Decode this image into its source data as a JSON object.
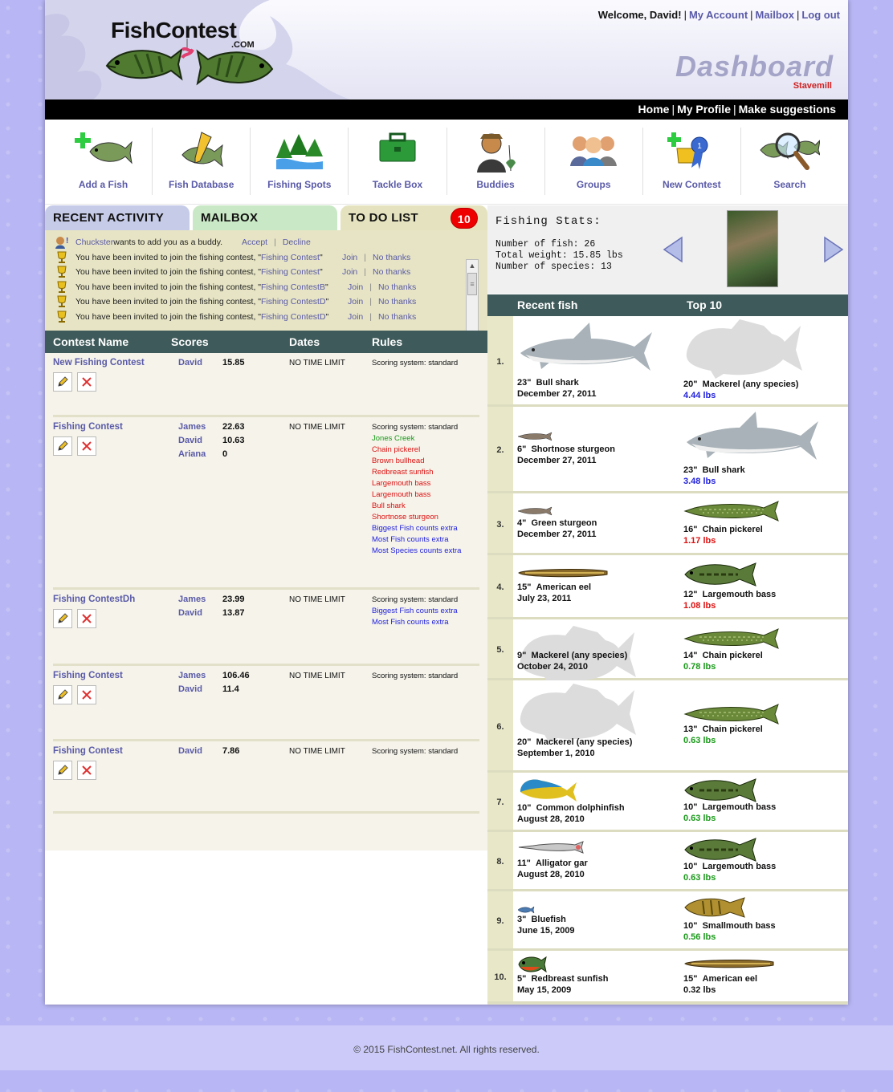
{
  "header": {
    "logo": "FishContest",
    "logo_sub": ".COM",
    "welcome": "Welcome, David!",
    "my_account": "My Account",
    "mailbox": "Mailbox",
    "logout": "Log out",
    "page_title": "Dashboard",
    "page_sub": "Stavemill"
  },
  "topnav": {
    "home": "Home",
    "profile": "My Profile",
    "suggest": "Make suggestions"
  },
  "iconbar": [
    {
      "label": "Add a Fish",
      "icon": "add-fish-icon"
    },
    {
      "label": "Fish Database",
      "icon": "fish-database-icon"
    },
    {
      "label": "Fishing Spots",
      "icon": "fishing-spots-icon"
    },
    {
      "label": "Tackle Box",
      "icon": "tackle-box-icon"
    },
    {
      "label": "Buddies",
      "icon": "buddies-icon"
    },
    {
      "label": "Groups",
      "icon": "groups-icon"
    },
    {
      "label": "New Contest",
      "icon": "new-contest-icon"
    },
    {
      "label": "Search",
      "icon": "search-icon"
    }
  ],
  "tabs": {
    "recent": "RECENT ACTIVITY",
    "mailbox": "MAILBOX",
    "todo": "TO DO LIST",
    "todo_count": "10"
  },
  "activity": [
    {
      "user": "Chuckster",
      "text": " wants to add you as a buddy.",
      "a1": "Accept",
      "a2": "Decline"
    },
    {
      "text": "You have been invited to join the fishing contest, \"",
      "contest": "Fishing Contest",
      "a1": "Join",
      "a2": "No thanks"
    },
    {
      "text": "You have been invited to join the fishing contest, \"",
      "contest": "Fishing Contest",
      "a1": "Join",
      "a2": "No thanks"
    },
    {
      "text": "You have been invited to join the fishing contest, \"",
      "contest": "Fishing ContestB",
      "a1": "Join",
      "a2": "No thanks"
    },
    {
      "text": "You have been invited to join the fishing contest, \"",
      "contest": "Fishing ContestD",
      "a1": "Join",
      "a2": "No thanks"
    },
    {
      "text": "You have been invited to join the fishing contest, \"",
      "contest": "Fishing ContestD",
      "a1": "Join",
      "a2": "No thanks"
    }
  ],
  "contest_table": {
    "headers": [
      "Contest Name",
      "Scores",
      "Dates",
      "Rules"
    ],
    "rows": [
      {
        "name": "New Fishing Contest",
        "players": [
          "David"
        ],
        "scores": [
          "15.85"
        ],
        "dates": "NO TIME LIMIT",
        "rules": [
          {
            "t": "Scoring system: standard",
            "c": ""
          }
        ]
      },
      {
        "name": "Fishing Contest",
        "players": [
          "James",
          "David",
          "Ariana"
        ],
        "scores": [
          "22.63",
          "10.63",
          "0"
        ],
        "dates": "NO TIME LIMIT",
        "rules": [
          {
            "t": "Scoring system: standard",
            "c": ""
          },
          {
            "t": "Jones Creek",
            "c": "r-green"
          },
          {
            "t": "Chain pickerel",
            "c": "r-red"
          },
          {
            "t": "Brown bullhead",
            "c": "r-red"
          },
          {
            "t": "Redbreast sunfish",
            "c": "r-red"
          },
          {
            "t": "Largemouth bass",
            "c": "r-red"
          },
          {
            "t": "Largemouth bass",
            "c": "r-red"
          },
          {
            "t": "Bull shark",
            "c": "r-red"
          },
          {
            "t": "Shortnose sturgeon",
            "c": "r-red"
          },
          {
            "t": "Biggest Fish counts extra",
            "c": "r-blue"
          },
          {
            "t": "Most Fish counts extra",
            "c": "r-blue"
          },
          {
            "t": "Most Species counts extra",
            "c": "r-blue"
          }
        ]
      },
      {
        "name": "Fishing ContestDh",
        "players": [
          "James",
          "David"
        ],
        "scores": [
          "23.99",
          "13.87"
        ],
        "dates": "NO TIME LIMIT",
        "rules": [
          {
            "t": "Scoring system: standard",
            "c": ""
          },
          {
            "t": "Biggest Fish counts extra",
            "c": "r-blue"
          },
          {
            "t": "Most Fish counts extra",
            "c": "r-blue"
          }
        ]
      },
      {
        "name": "Fishing Contest",
        "players": [
          "James",
          "David"
        ],
        "scores": [
          "106.46",
          "11.4"
        ],
        "dates": "NO TIME LIMIT",
        "rules": [
          {
            "t": "Scoring system: standard",
            "c": ""
          }
        ]
      },
      {
        "name": "Fishing Contest",
        "players": [
          "David"
        ],
        "scores": [
          "7.86"
        ],
        "dates": "NO TIME LIMIT",
        "rules": [
          {
            "t": "Scoring system: standard",
            "c": ""
          }
        ]
      }
    ]
  },
  "stats": {
    "title": "Fishing Stats:",
    "lines": [
      "Number of fish: 26",
      "Total weight: 15.85 lbs",
      "Number of species: 13"
    ]
  },
  "fish_headers": {
    "recent": "Recent fish",
    "top": "Top 10"
  },
  "fish_rows": [
    {
      "num": "1.",
      "recent": {
        "size": "23\"",
        "name": "Bull shark",
        "date": "December 27, 2011",
        "icon": "shark"
      },
      "top": {
        "size": "20\"",
        "name": "Mackerel (any species)",
        "weight": "4.44 lbs",
        "wc": "w-blue",
        "icon": "ghost"
      }
    },
    {
      "num": "2.",
      "recent": {
        "size": "6\"",
        "name": "Shortnose sturgeon",
        "date": "December 27, 2011",
        "icon": "sturgeon"
      },
      "top": {
        "size": "23\"",
        "name": "Bull shark",
        "weight": "3.48 lbs",
        "wc": "w-blue",
        "icon": "shark"
      }
    },
    {
      "num": "3.",
      "recent": {
        "size": "4\"",
        "name": "Green sturgeon",
        "date": "December 27, 2011",
        "icon": "sturgeon"
      },
      "top": {
        "size": "16\"",
        "name": "Chain pickerel",
        "weight": "1.17 lbs",
        "wc": "w-red",
        "icon": "pickerel"
      }
    },
    {
      "num": "4.",
      "recent": {
        "size": "15\"",
        "name": "American eel",
        "date": "July 23, 2011",
        "icon": "eel"
      },
      "top": {
        "size": "12\"",
        "name": "Largemouth bass",
        "weight": "1.08 lbs",
        "wc": "w-red",
        "icon": "bass"
      }
    },
    {
      "num": "5.",
      "recent": {
        "size": "9\"",
        "name": "Mackerel (any species)",
        "date": "October 24, 2010",
        "icon": "ghost"
      },
      "top": {
        "size": "14\"",
        "name": "Chain pickerel",
        "weight": "0.78 lbs",
        "wc": "w-green",
        "icon": "pickerel"
      }
    },
    {
      "num": "6.",
      "recent": {
        "size": "20\"",
        "name": "Mackerel (any species)",
        "date": "September 1, 2010",
        "icon": "ghost"
      },
      "top": {
        "size": "13\"",
        "name": "Chain pickerel",
        "weight": "0.63 lbs",
        "wc": "w-green",
        "icon": "pickerel"
      }
    },
    {
      "num": "7.",
      "recent": {
        "size": "10\"",
        "name": "Common dolphinfish",
        "date": "August 28, 2010",
        "icon": "dolphinfish"
      },
      "top": {
        "size": "10\"",
        "name": "Largemouth bass",
        "weight": "0.63 lbs",
        "wc": "w-green",
        "icon": "bass"
      }
    },
    {
      "num": "8.",
      "recent": {
        "size": "11\"",
        "name": "Alligator gar",
        "date": "August 28, 2010",
        "icon": "gar"
      },
      "top": {
        "size": "10\"",
        "name": "Largemouth bass",
        "weight": "0.63 lbs",
        "wc": "w-green",
        "icon": "bass"
      }
    },
    {
      "num": "9.",
      "recent": {
        "size": "3\"",
        "name": "Bluefish",
        "date": "June 15, 2009",
        "icon": "bluefish"
      },
      "top": {
        "size": "10\"",
        "name": "Smallmouth bass",
        "weight": "0.56 lbs",
        "wc": "w-green",
        "icon": "smallmouth"
      }
    },
    {
      "num": "10.",
      "recent": {
        "size": "5\"",
        "name": "Redbreast sunfish",
        "date": "May 15, 2009",
        "icon": "sunfish"
      },
      "top": {
        "size": "15\"",
        "name": "American eel",
        "weight": "0.32 lbs",
        "wc": "",
        "icon": "eel"
      }
    }
  ],
  "footer": "© 2015 FishContest.net. All rights reserved."
}
